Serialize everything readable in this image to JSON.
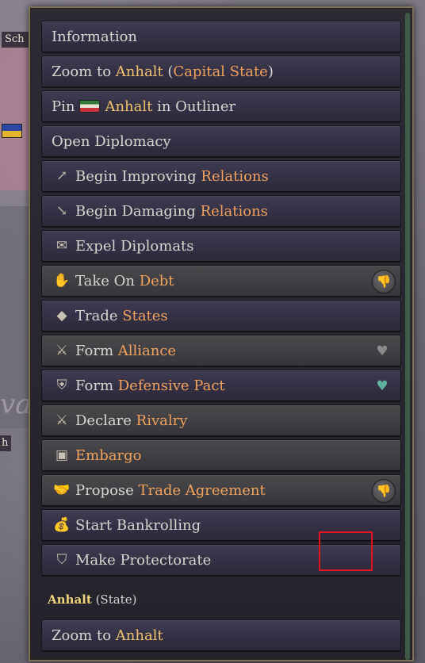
{
  "map": {
    "label_top": "Sch",
    "label_mid": "h",
    "map_text": "va"
  },
  "menu": {
    "items": [
      {
        "id": "information",
        "style": "purple",
        "icon": "",
        "parts": [
          {
            "t": "Information",
            "c": ""
          }
        ]
      },
      {
        "id": "zoom-capital",
        "style": "purple",
        "icon": "",
        "parts": [
          {
            "t": "Zoom to ",
            "c": ""
          },
          {
            "t": "Anhalt",
            "c": "hl"
          },
          {
            "t": " (",
            "c": ""
          },
          {
            "t": "Capital State",
            "c": "hl2"
          },
          {
            "t": ")",
            "c": ""
          }
        ]
      },
      {
        "id": "pin-outliner",
        "style": "purple",
        "icon": "",
        "flag": true,
        "parts": [
          {
            "t": "Pin",
            "c": ""
          },
          {
            "t": "FLAG",
            "c": "flag"
          },
          {
            "t": "Anhalt",
            "c": "hl"
          },
          {
            "t": " in Outliner",
            "c": ""
          }
        ]
      },
      {
        "id": "open-diplomacy",
        "style": "purple",
        "icon": "",
        "parts": [
          {
            "t": "Open Diplomacy",
            "c": ""
          }
        ]
      },
      {
        "id": "improve-relations",
        "style": "purple",
        "icon": "↗",
        "icon_name": "improve-relations-icon",
        "parts": [
          {
            "t": "Begin Improving ",
            "c": ""
          },
          {
            "t": "Relations",
            "c": "hl2"
          }
        ]
      },
      {
        "id": "damage-relations",
        "style": "purple",
        "icon": "↘",
        "icon_name": "damage-relations-icon",
        "parts": [
          {
            "t": "Begin Damaging ",
            "c": ""
          },
          {
            "t": "Relations",
            "c": "hl2"
          }
        ]
      },
      {
        "id": "expel-diplomats",
        "style": "purple",
        "icon": "✉",
        "icon_name": "expel-diplomats-icon",
        "parts": [
          {
            "t": "Expel Diplomats",
            "c": ""
          }
        ]
      },
      {
        "id": "take-on-debt",
        "style": "grey",
        "icon": "✋",
        "icon_name": "take-debt-icon",
        "badge": "thumbs-down",
        "parts": [
          {
            "t": "Take On ",
            "c": ""
          },
          {
            "t": "Debt",
            "c": "hl2"
          }
        ]
      },
      {
        "id": "trade-states",
        "style": "purple",
        "icon": "◆",
        "icon_name": "trade-states-icon",
        "parts": [
          {
            "t": "Trade ",
            "c": ""
          },
          {
            "t": "States",
            "c": "hl2"
          }
        ]
      },
      {
        "id": "form-alliance",
        "style": "grey",
        "icon": "⚔",
        "icon_name": "alliance-icon",
        "hand": "grey",
        "parts": [
          {
            "t": "Form ",
            "c": ""
          },
          {
            "t": "Alliance",
            "c": "hl2"
          }
        ]
      },
      {
        "id": "defensive-pact",
        "style": "purple",
        "icon": "⛨",
        "icon_name": "defensive-pact-icon",
        "hand": "teal",
        "parts": [
          {
            "t": "Form ",
            "c": ""
          },
          {
            "t": "Defensive Pact",
            "c": "hl2"
          }
        ]
      },
      {
        "id": "declare-rivalry",
        "style": "grey",
        "icon": "⚔",
        "icon_name": "rivalry-icon",
        "parts": [
          {
            "t": "Declare ",
            "c": ""
          },
          {
            "t": "Rivalry",
            "c": "hl2"
          }
        ]
      },
      {
        "id": "embargo",
        "style": "grey",
        "icon": "▣",
        "icon_name": "embargo-icon",
        "parts": [
          {
            "t": "Embargo",
            "c": "hl2"
          }
        ]
      },
      {
        "id": "trade-agreement",
        "style": "grey",
        "icon": "🤝",
        "icon_name": "handshake-icon",
        "badge": "thumbs-down",
        "parts": [
          {
            "t": "Propose ",
            "c": ""
          },
          {
            "t": "Trade Agreement",
            "c": "hl2"
          }
        ]
      },
      {
        "id": "bankrolling",
        "style": "purple",
        "icon": "💰",
        "icon_name": "money-bag-icon",
        "parts": [
          {
            "t": "Start Bankrolling",
            "c": ""
          }
        ]
      },
      {
        "id": "protectorate",
        "style": "purple",
        "icon": "⛉",
        "icon_name": "protectorate-icon",
        "parts": [
          {
            "t": "Make Protectorate",
            "c": ""
          }
        ]
      }
    ]
  },
  "state_section": {
    "name": "Anhalt",
    "suffix": " (State)"
  },
  "state_zoom": {
    "prefix": "Zoom to ",
    "name": "Anhalt"
  },
  "colors": {
    "highlight": "#f0c36b",
    "keyword": "#f0a25c",
    "panel_border": "#7c7158"
  }
}
